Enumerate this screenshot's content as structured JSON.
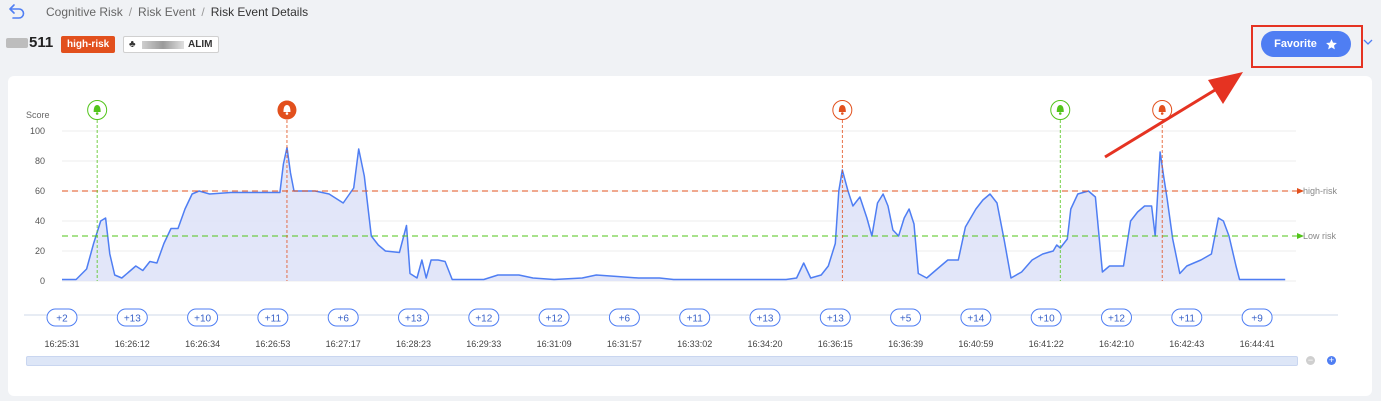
{
  "breadcrumb": {
    "items": [
      "Cognitive Risk",
      "Risk Event",
      "Risk Event Details"
    ]
  },
  "header": {
    "id_suffix": "511",
    "risk_badge": "high-risk",
    "user_suffix": "ALIM",
    "favorite_label": "Favorite"
  },
  "colors": {
    "accent": "#4f7ef3",
    "high_risk": "#e2501d",
    "low_risk": "#52c41a",
    "annotation": "#e53322",
    "series_fill": "#dfe3f8"
  },
  "chart_data": {
    "type": "area",
    "ylabel": "Score",
    "ylim": [
      0,
      100
    ],
    "yticks": [
      0,
      20,
      40,
      60,
      80,
      100
    ],
    "thresholds": [
      {
        "name": "high-risk",
        "value": 60,
        "color": "#e2501d"
      },
      {
        "name": "Low risk",
        "value": 30,
        "color": "#52c41a"
      }
    ],
    "x_labels": [
      "16:25:31",
      "16:26:12",
      "16:26:34",
      "16:26:53",
      "16:27:17",
      "16:28:23",
      "16:29:33",
      "16:31:09",
      "16:31:57",
      "16:33:02",
      "16:34:20",
      "16:36:15",
      "16:36:39",
      "16:40:59",
      "16:41:22",
      "16:42:10",
      "16:42:43",
      "16:44:41"
    ],
    "event_counts": [
      "+2",
      "+13",
      "+10",
      "+11",
      "+6",
      "+13",
      "+12",
      "+12",
      "+6",
      "+11",
      "+13",
      "+13",
      "+5",
      "+14",
      "+10",
      "+12",
      "+11",
      "+9"
    ],
    "alerts": [
      {
        "x": 0.5,
        "level": "low"
      },
      {
        "x": 3.2,
        "level": "high",
        "selected": true
      },
      {
        "x": 11.1,
        "level": "high"
      },
      {
        "x": 14.2,
        "level": "low"
      },
      {
        "x": 15.65,
        "level": "high"
      }
    ],
    "series": [
      {
        "points": [
          [
            0,
            1
          ],
          [
            0.2,
            1
          ],
          [
            0.35,
            8
          ],
          [
            0.45,
            25
          ],
          [
            0.55,
            40
          ],
          [
            0.62,
            42
          ],
          [
            0.68,
            18
          ],
          [
            0.75,
            4
          ],
          [
            0.85,
            2
          ],
          [
            0.95,
            6
          ],
          [
            1.05,
            10
          ],
          [
            1.15,
            7
          ],
          [
            1.25,
            13
          ],
          [
            1.35,
            12
          ],
          [
            1.45,
            25
          ],
          [
            1.55,
            35
          ],
          [
            1.65,
            35
          ],
          [
            1.75,
            48
          ],
          [
            1.85,
            58
          ],
          [
            1.95,
            60
          ],
          [
            2.1,
            58
          ],
          [
            2.4,
            59
          ],
          [
            2.8,
            59
          ],
          [
            3.1,
            59
          ],
          [
            3.15,
            78
          ],
          [
            3.2,
            89
          ],
          [
            3.25,
            72
          ],
          [
            3.3,
            60
          ],
          [
            3.6,
            60
          ],
          [
            3.8,
            58
          ],
          [
            4.0,
            52
          ],
          [
            4.15,
            62
          ],
          [
            4.22,
            88
          ],
          [
            4.3,
            70
          ],
          [
            4.4,
            30
          ],
          [
            4.5,
            24
          ],
          [
            4.6,
            20
          ],
          [
            4.8,
            19
          ],
          [
            4.9,
            37
          ],
          [
            4.95,
            5
          ],
          [
            5.05,
            2
          ],
          [
            5.12,
            14
          ],
          [
            5.18,
            2
          ],
          [
            5.25,
            14
          ],
          [
            5.35,
            14
          ],
          [
            5.45,
            13
          ],
          [
            5.55,
            1
          ],
          [
            6.0,
            1
          ],
          [
            6.2,
            4
          ],
          [
            6.5,
            4
          ],
          [
            6.7,
            2
          ],
          [
            7.0,
            1
          ],
          [
            7.4,
            2
          ],
          [
            7.6,
            4
          ],
          [
            7.9,
            3
          ],
          [
            8.2,
            2
          ],
          [
            8.5,
            2
          ],
          [
            8.7,
            1
          ],
          [
            9.5,
            1
          ],
          [
            10.3,
            1
          ],
          [
            10.45,
            2
          ],
          [
            10.55,
            12
          ],
          [
            10.65,
            2
          ],
          [
            10.8,
            4
          ],
          [
            10.9,
            10
          ],
          [
            11.0,
            25
          ],
          [
            11.05,
            60
          ],
          [
            11.1,
            74
          ],
          [
            11.18,
            60
          ],
          [
            11.25,
            50
          ],
          [
            11.35,
            56
          ],
          [
            11.45,
            42
          ],
          [
            11.52,
            30
          ],
          [
            11.6,
            52
          ],
          [
            11.68,
            58
          ],
          [
            11.75,
            50
          ],
          [
            11.82,
            34
          ],
          [
            11.9,
            30
          ],
          [
            11.98,
            42
          ],
          [
            12.05,
            48
          ],
          [
            12.12,
            38
          ],
          [
            12.18,
            5
          ],
          [
            12.3,
            2
          ],
          [
            12.45,
            8
          ],
          [
            12.6,
            14
          ],
          [
            12.75,
            14
          ],
          [
            12.85,
            36
          ],
          [
            13.0,
            48
          ],
          [
            13.1,
            54
          ],
          [
            13.2,
            58
          ],
          [
            13.3,
            52
          ],
          [
            13.4,
            28
          ],
          [
            13.5,
            2
          ],
          [
            13.65,
            6
          ],
          [
            13.8,
            14
          ],
          [
            13.95,
            18
          ],
          [
            14.1,
            20
          ],
          [
            14.15,
            24
          ],
          [
            14.2,
            22
          ],
          [
            14.3,
            28
          ],
          [
            14.35,
            48
          ],
          [
            14.45,
            58
          ],
          [
            14.6,
            60
          ],
          [
            14.7,
            56
          ],
          [
            14.8,
            6
          ],
          [
            14.9,
            10
          ],
          [
            15.0,
            10
          ],
          [
            15.1,
            10
          ],
          [
            15.2,
            40
          ],
          [
            15.3,
            46
          ],
          [
            15.4,
            50
          ],
          [
            15.5,
            50
          ],
          [
            15.55,
            30
          ],
          [
            15.62,
            86
          ],
          [
            15.67,
            70
          ],
          [
            15.72,
            55
          ],
          [
            15.8,
            28
          ],
          [
            15.9,
            5
          ],
          [
            16.0,
            10
          ],
          [
            16.1,
            12
          ],
          [
            16.2,
            14
          ],
          [
            16.35,
            18
          ],
          [
            16.45,
            42
          ],
          [
            16.52,
            40
          ],
          [
            16.6,
            30
          ],
          [
            16.7,
            10
          ],
          [
            16.75,
            1
          ],
          [
            17.4,
            1
          ]
        ]
      }
    ],
    "grid": true
  }
}
